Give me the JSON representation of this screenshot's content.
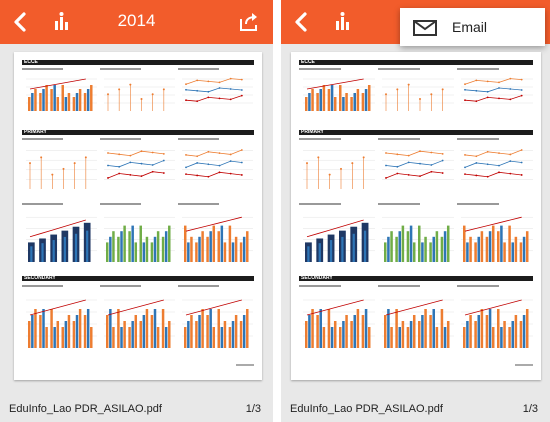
{
  "left": {
    "title": "2014",
    "file_name": "EduInfo_Lao PDR_ASILAO.pdf",
    "page_indicator": "1/3"
  },
  "right": {
    "file_name": "EduInfo_Lao PDR_ASILAO.pdf",
    "page_indicator": "1/3",
    "menu": {
      "email_label": "Email"
    }
  },
  "icons": {
    "back": "chevron-left-icon",
    "brand": "agency-logo-icon",
    "share": "share-icon",
    "email": "envelope-icon"
  },
  "colors": {
    "appbar": "#f25c2b",
    "background": "#e8e8e8",
    "accent_orange": "#ed7d31",
    "accent_blue": "#2e75b6",
    "accent_green": "#70ad47",
    "accent_red": "#c00000"
  },
  "document": {
    "sections": [
      "ECCE",
      "PRIMARY",
      "SECONDARY"
    ]
  }
}
